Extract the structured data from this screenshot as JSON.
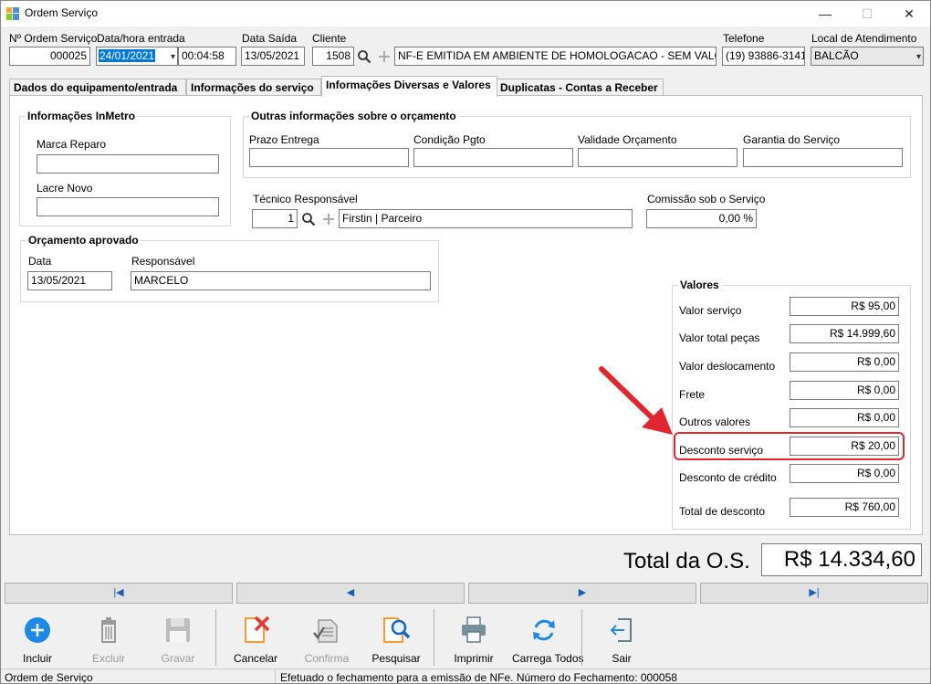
{
  "window": {
    "title": "Ordem Serviço",
    "min_glyph": "—",
    "max_glyph": "☐",
    "close_glyph": "✕"
  },
  "header": {
    "os_label": "Nº Ordem Serviço",
    "os_value": "000025",
    "entrada_label": "Data/hora entrada",
    "entrada_date": "24/01/2021",
    "entrada_time": "00:04:58",
    "saida_label": "Data Saída",
    "saida_value": "13/05/2021",
    "cliente_label": "Cliente",
    "cliente_code": "1508",
    "cliente_name": "NF-E EMITIDA EM AMBIENTE DE HOMOLOGACAO - SEM VALOR FISC",
    "telefone_label": "Telefone",
    "telefone_value": "(19) 93886-3141",
    "local_label": "Local de Atendimento",
    "local_value": "BALCÃO"
  },
  "tabs": [
    {
      "label": "Dados do equipamento/entrada"
    },
    {
      "label": "Informações do serviço"
    },
    {
      "label": "Informações Diversas e Valores",
      "active": true
    },
    {
      "label": "Duplicatas - Contas a Receber"
    }
  ],
  "inmetro": {
    "title": "Informações InMetro",
    "marca_label": "Marca Reparo",
    "marca_value": "",
    "lacre_label": "Lacre Novo",
    "lacre_value": ""
  },
  "outras": {
    "title": "Outras informações sobre o orçamento",
    "prazo_label": "Prazo Entrega",
    "prazo_value": "",
    "condicao_label": "Condição Pgto",
    "condicao_value": "",
    "validade_label": "Validade Orçamento",
    "validade_value": "",
    "garantia_label": "Garantia do Serviço",
    "garantia_value": ""
  },
  "tecnico": {
    "label": "Técnico Responsável",
    "code": "1",
    "name": "Firstin | Parceiro"
  },
  "comissao": {
    "label": "Comissão sob o Serviço",
    "value": "0,00 %"
  },
  "orcamento": {
    "title": "Orçamento aprovado",
    "data_label": "Data",
    "data_value": "13/05/2021",
    "resp_label": "Responsável",
    "resp_value": "MARCELO"
  },
  "valores": {
    "title": "Valores",
    "rows": [
      {
        "label": "Valor serviço",
        "value": "R$ 95,00"
      },
      {
        "label": "Valor total peças",
        "value": "R$ 14.999,60"
      },
      {
        "label": "Valor deslocamento",
        "value": "R$ 0,00"
      },
      {
        "label": "Frete",
        "value": "R$ 0,00"
      },
      {
        "label": "Outros valores",
        "value": "R$ 0,00"
      },
      {
        "label": "Desconto serviço",
        "value": "R$ 20,00"
      },
      {
        "label": "Desconto de crédito",
        "value": "R$ 0,00"
      },
      {
        "label": "Total de desconto",
        "value": "R$ 760,00"
      }
    ]
  },
  "total": {
    "label": "Total da O.S.",
    "value": "R$ 14.334,60"
  },
  "nav": {
    "first": "|◀",
    "prev": "◀",
    "next": "▶",
    "last": "▶|"
  },
  "toolbar": {
    "incluir": "Incluir",
    "excluir": "Excluir",
    "gravar": "Gravar",
    "cancelar": "Cancelar",
    "confirma": "Confirma",
    "pesquisar": "Pesquisar",
    "imprimir": "Imprimir",
    "carrega": "Carrega Todos",
    "sair": "Sair"
  },
  "status": {
    "left": "Ordem de Serviço",
    "message": "Efetuado o fechamento para a emissão de NFe. Número do Fechamento: 000058"
  },
  "colors": {
    "accent": "#0078d7",
    "highlight": "#e0262e",
    "nav_arrow": "#1a5fb4"
  }
}
